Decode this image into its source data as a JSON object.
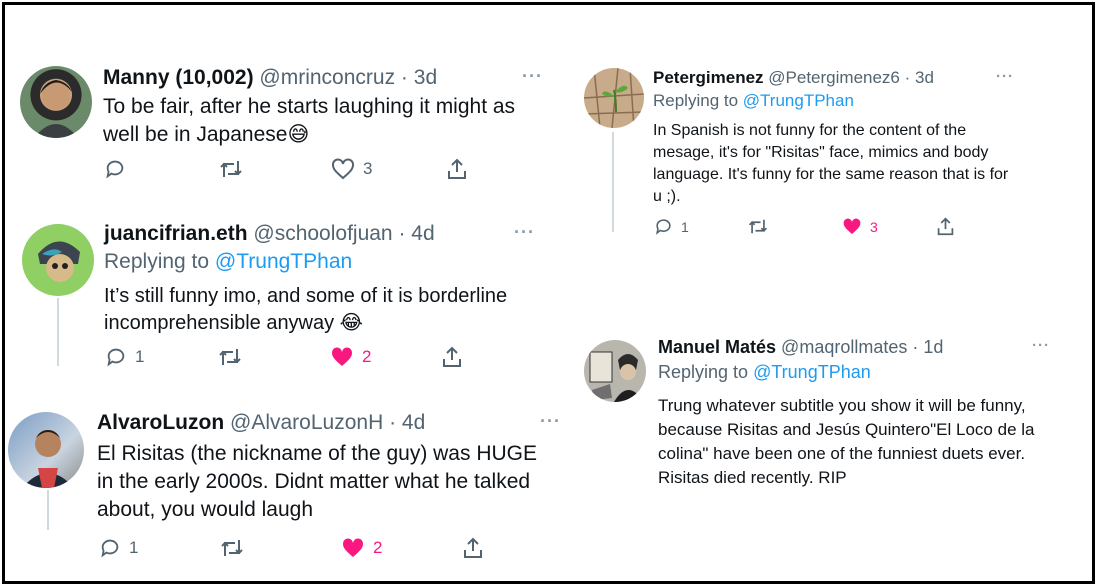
{
  "tweets": [
    {
      "name": "Manny (10,002)",
      "handle": "@mrinconcruz",
      "time": "3d",
      "text": "To be fair, after he starts laughing it might as well be in Japanese😅",
      "replies": "",
      "likes": "3"
    },
    {
      "name": "juancifrian.eth",
      "handle": "@schoolofjuan",
      "time": "4d",
      "replying_prefix": "Replying to",
      "replying_to": "@TrungTPhan",
      "text": "It’s still funny imo, and some of it is borderline incomprehensible anyway 😂",
      "replies": "1",
      "likes": "2"
    },
    {
      "name": "AlvaroLuzon",
      "handle": "@AlvaroLuzonH",
      "time": "4d",
      "text": "El Risitas (the nickname of the guy) was HUGE in the early 2000s. Didnt matter what he talked about, you would laugh",
      "replies": "1",
      "likes": "2"
    },
    {
      "name": "Petergimenez",
      "handle": "@Petergimenez6",
      "time": "3d",
      "replying_prefix": "Replying to",
      "replying_to": "@TrungTPhan",
      "text": "In Spanish is not funny for the content of the mesage, it's for \"Risitas\" face, mimics and body language. It's funny for the same reason that is for u ;).",
      "replies": "1",
      "likes": "3"
    },
    {
      "name": "Manuel Matés",
      "handle": "@maqrollmates",
      "time": "1d",
      "replying_prefix": "Replying to",
      "replying_to": "@TrungTPhan",
      "text": "Trung whatever subtitle you show it will be funny, because Risitas and Jesús Quintero\"El Loco de la colina\" have been one of the funniest duets ever. Risitas died recently. RIP"
    }
  ],
  "separator": " · ",
  "more": "···",
  "colors": {
    "like": "#f91880",
    "link": "#1d9bf0",
    "meta": "#536471"
  }
}
